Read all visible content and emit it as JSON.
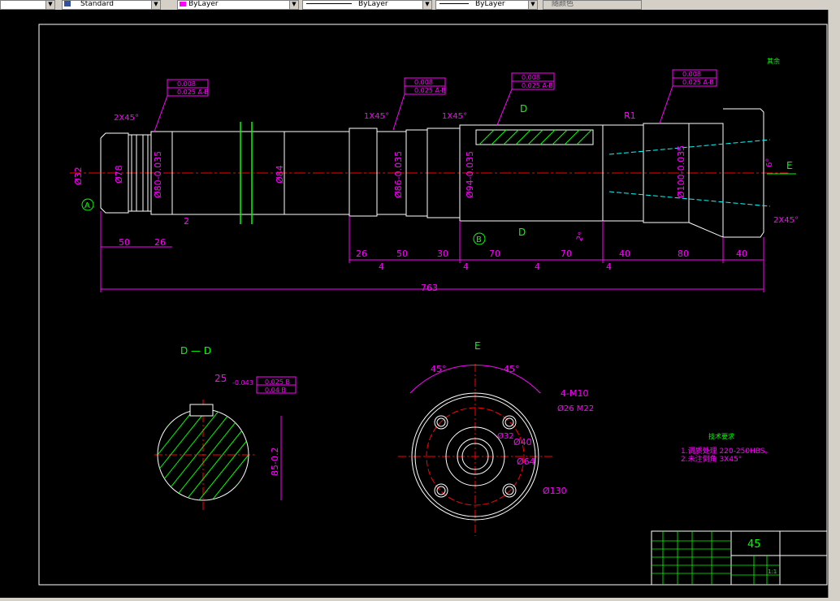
{
  "toolbar": {
    "textstyle_value": "Standard",
    "layer_value": "ByLayer",
    "linetype_value": "ByLayer",
    "lineweight_value": "ByLayer",
    "plotstyle_value": "随颜色",
    "color_swatch": "#ff00ff"
  },
  "drawing": {
    "colors": {
      "dim": "#ff00ff",
      "outline": "#ffffff",
      "center": "#ff0000",
      "hatch": "#00ff00",
      "hidden": "#00ffff",
      "text": "#00ff00"
    },
    "roughness_top": "其余",
    "dims_vertical": [
      "Ø32",
      "Ø78",
      "Ø80-0.035",
      "Ø84",
      "Ø86-0.035",
      "Ø94-0.035",
      "Ø100-0.035"
    ],
    "chamfers": [
      "2X45°",
      "1X45°",
      "1X45°",
      "2X45°"
    ],
    "fcf": [
      "0.008",
      "0.025 A-B"
    ],
    "dims_horizontal": [
      "50",
      "26",
      "2",
      "26",
      "50",
      "30",
      "70",
      "70",
      "40",
      "80",
      "40",
      "4",
      "4",
      "4",
      "4"
    ],
    "total_length": "763",
    "datum_a": "A",
    "datum_b": "B",
    "section_d": "D",
    "view_e": "E",
    "angle_2": "2°",
    "angle_6": "6°",
    "radius": "R1",
    "section_title": "D — D",
    "key_width": "25",
    "key_tol": "-0.043",
    "key_fcf": [
      "0.025 B",
      "0.04 B"
    ],
    "key_depth": "85-0.2",
    "view_e_title": "E",
    "angle_45_left": "45°",
    "angle_45_right": "45°",
    "thread": "4-M10",
    "counterbore": "Ø26 M22",
    "dia_32": "Ø32",
    "dia_40": "Ø40",
    "dia_64": "Ø64",
    "dia_130": "Ø130",
    "tech_title": "技术要求",
    "tech_line1": "1.调质处理 220-250HBS。",
    "tech_line2": "2.未注倒角 3X45°",
    "title_number": "45",
    "title_scale": "1:1"
  }
}
